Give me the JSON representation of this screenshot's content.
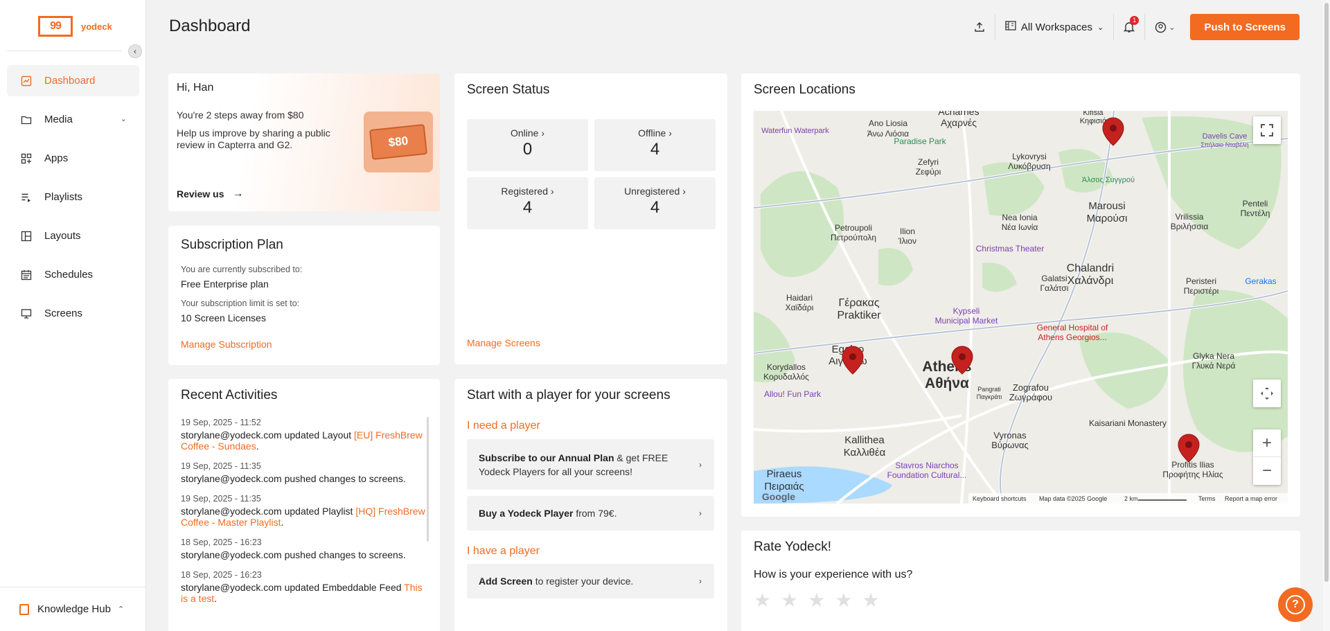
{
  "brand": {
    "logo_mark": "99",
    "name": "yodeck",
    "accent": "#f26b21"
  },
  "sidebar": {
    "items": [
      {
        "label": "Dashboard",
        "icon": "chart-line-icon"
      },
      {
        "label": "Media",
        "icon": "folder-icon"
      },
      {
        "label": "Apps",
        "icon": "apps-grid-icon"
      },
      {
        "label": "Playlists",
        "icon": "playlist-icon"
      },
      {
        "label": "Layouts",
        "icon": "layout-icon"
      },
      {
        "label": "Schedules",
        "icon": "calendar-icon"
      },
      {
        "label": "Screens",
        "icon": "monitor-icon"
      }
    ],
    "knowledge_hub": "Knowledge Hub"
  },
  "header": {
    "title": "Dashboard",
    "workspace": "All Workspaces",
    "notification_count": "1",
    "push_button": "Push to Screens"
  },
  "greeting": {
    "name": "Hi, Han",
    "line1": "You're 2 steps away from $80",
    "line2": "Help us improve by sharing a public review in Capterra and G2.",
    "review": "Review us",
    "ticket_value": "$80"
  },
  "subscription": {
    "title": "Subscription Plan",
    "label1": "You are currently subscribed to:",
    "value1": "Free Enterprise plan",
    "label2": "Your subscription limit is set to:",
    "value2": "10 Screen Licenses",
    "link": "Manage Subscription"
  },
  "recent": {
    "title": "Recent Activities",
    "items": [
      {
        "date": "19 Sep, 2025 - 11:52",
        "text": "storylane@yodeck.com updated Layout ",
        "highlight": "[EU] FreshBrew Coffee - Sundaes",
        "suffix": "."
      },
      {
        "date": "19 Sep, 2025 - 11:35",
        "text": "storylane@yodeck.com pushed changes to screens.",
        "highlight": "",
        "suffix": ""
      },
      {
        "date": "19 Sep, 2025 - 11:35",
        "text": "storylane@yodeck.com updated Playlist ",
        "highlight": "[HQ] FreshBrew Coffee - Master Playlist",
        "suffix": "."
      },
      {
        "date": "18 Sep, 2025 - 16:23",
        "text": "storylane@yodeck.com pushed changes to screens.",
        "highlight": "",
        "suffix": ""
      },
      {
        "date": "18 Sep, 2025 - 16:23",
        "text": "storylane@yodeck.com updated Embeddable Feed ",
        "highlight": "This is a test",
        "suffix": "."
      }
    ]
  },
  "status": {
    "title": "Screen Status",
    "stats": [
      {
        "label": "Online",
        "value": "0"
      },
      {
        "label": "Offline",
        "value": "4"
      },
      {
        "label": "Registered",
        "value": "4"
      },
      {
        "label": "Unregistered",
        "value": "4"
      }
    ],
    "link": "Manage Screens"
  },
  "start": {
    "title": "Start with a player for your screens",
    "need": "I need a player",
    "opt1_bold": "Subscribe to our Annual Plan",
    "opt1_rest": " & get FREE Yodeck Players for all your screens!",
    "opt2_bold": "Buy a Yodeck Player",
    "opt2_rest": " from 79€.",
    "have": "I have a player",
    "opt3_bold": "Add Screen",
    "opt3_rest": " to register your device."
  },
  "locations": {
    "title": "Screen Locations",
    "map_labels": [
      "Acharnes",
      "Αχαρνές",
      "Ano Liosia",
      "Άνω Λιόσια",
      "Kifisia",
      "Κηφισιά",
      "Davelis Cave",
      "Σπήλαιο Νταβέλη",
      "Waterfun Waterpark",
      "Paradise Park",
      "Zefyri",
      "Ζεφύρι",
      "Lykovrysi",
      "Λυκόβρυση",
      "Άλσος Συγγρού",
      "Marousi",
      "Μαρούσι",
      "Penteli",
      "Πεντέλη",
      "Vrilissia",
      "Βριλήσσια",
      "Nea Ionia",
      "Νέα Ιωνία",
      "Petroupoli",
      "Πετρούπολη",
      "Ilion",
      "Ίλιον",
      "Christmas Theater",
      "Chalandri",
      "Χαλάνδρι",
      "Peristeri",
      "Περιστέρι",
      "Galatsi",
      "Γαλάτσι",
      "Gerakas",
      "Γέρακας",
      "Praktiker",
      "Haidari",
      "Χαϊδάρι",
      "Kypseli",
      "Municipal Market",
      "General Hospital of",
      "Athens Georgios...",
      "Egaleo",
      "Αιγάλεω",
      "Athens",
      "Αθήνα",
      "Glyka Nera",
      "Γλυκά Νερά",
      "Korydallos",
      "Κορυδαλλός",
      "Zografou",
      "Ζωγράφου",
      "Allou! Fun Park",
      "Pangrati",
      "Παγκράτι",
      "Kaisariani Monastery",
      "Vyronas",
      "Βύρωνας",
      "Kallithea",
      "Καλλιθέα",
      "Profitis Ilias",
      "Προφήτης Ηλίας",
      "Stavros Niarchos",
      "Foundation Cultural...",
      "Piraeus",
      "Πειραιάς",
      "Google"
    ],
    "footer": [
      "Keyboard shortcuts",
      "Map data ©2025 Google",
      "2 km",
      "Terms",
      "Report a map error"
    ]
  },
  "rating": {
    "title": "Rate Yodeck!",
    "question": "How is your experience with us?",
    "stars": 5,
    "selected": 0
  }
}
